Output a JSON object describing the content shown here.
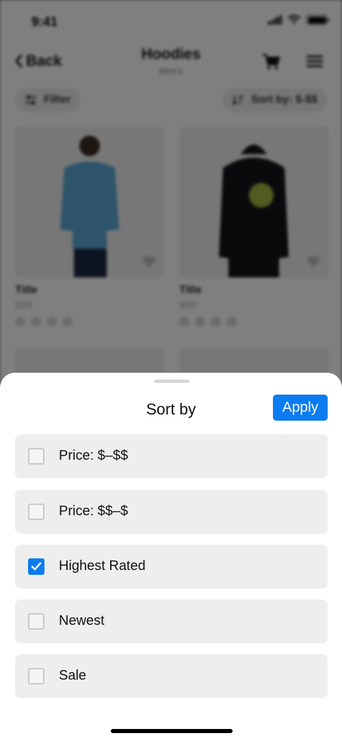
{
  "status": {
    "time": "9:41"
  },
  "nav": {
    "back_label": "Back",
    "title": "Hoodies",
    "subtitle": "Men's"
  },
  "toolbar": {
    "filter_label": "Filter",
    "sort_label": "Sort by: $-$$"
  },
  "products": [
    {
      "title": "Title",
      "price": "$99",
      "color": "#5aa9d4"
    },
    {
      "title": "Title",
      "price": "$99",
      "color": "#15151a"
    }
  ],
  "sheet": {
    "title": "Sort by",
    "apply_label": "Apply",
    "options": [
      {
        "label": "Price: $–$$",
        "checked": false
      },
      {
        "label": "Price: $$–$",
        "checked": false
      },
      {
        "label": "Highest Rated",
        "checked": true
      },
      {
        "label": "Newest",
        "checked": false
      },
      {
        "label": "Sale",
        "checked": false
      }
    ]
  },
  "colors": {
    "accent": "#0a7cf0",
    "option_bg": "#eeeeee",
    "scrim": "rgba(0,0,0,0.5)"
  }
}
